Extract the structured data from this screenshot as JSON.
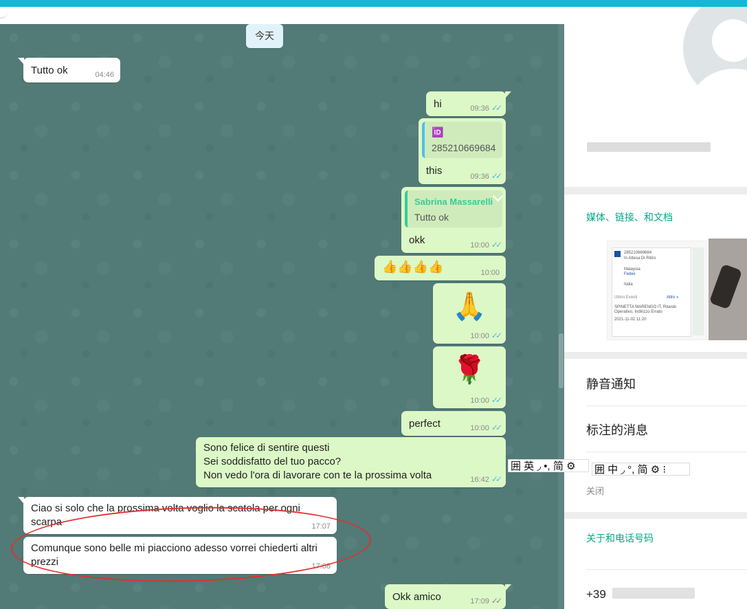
{
  "date_chip": "今天",
  "messages": [
    {
      "text": "Tutto ok",
      "time": "04:46"
    },
    {
      "text": "hi",
      "time": "09:36",
      "ticks": "✓✓"
    },
    {
      "quote_icon": "🆔",
      "quote_text": "285210669684",
      "text": "this",
      "time": "09:36",
      "ticks": "✓✓"
    },
    {
      "quote_name": "Sabrina Massarelli",
      "quote_text": "Tutto ok",
      "text": "okk",
      "time": "10:00",
      "ticks": "✓✓"
    },
    {
      "text": "👍👍👍👍",
      "time": "10:00"
    },
    {
      "text": "🙏",
      "time": "10:00",
      "ticks": "✓✓"
    },
    {
      "text": "🌹",
      "time": "10:00",
      "ticks": "✓✓"
    },
    {
      "text": "perfect",
      "time": "10:00",
      "ticks": "✓✓"
    },
    {
      "text": "Sono felice di sentire questi\nSei soddisfatto del tuo pacco?\nNon vedo l'ora di lavorare con te la prossima volta",
      "time": "16:42",
      "ticks": "✓✓"
    },
    {
      "text": "Ciao si solo che la prossima volta voglio la scatola per ogni\nscarpa",
      "time": "17:07"
    },
    {
      "text": "Comunque sono belle mi piacciono adesso vorrei chiederti altri\nprezzi",
      "time": "17:08"
    },
    {
      "text": "Okk amico",
      "time": "17:09",
      "ticks": "✓✓"
    }
  ],
  "panel": {
    "media_title": "媒体、链接、和文档",
    "thumb_lines": [
      "285210669684",
      "In Attesa Di Ritiro",
      "Malaysia",
      "Fedex",
      "Italia",
      "Ultimi Eventi",
      "Altro »",
      "SPINETTA MARENGO IT, Ritardo",
      "Operativo, Indirizzo Errato",
      "2021-11-02 11:20"
    ],
    "mute_label": "静音通知",
    "starred_label": "标注的消息",
    "disappearing_sub": "关闭",
    "about_title": "关于和电话号码",
    "phone_prefix": "+39"
  },
  "ime_bars": [
    {
      "text": "囲 英 ◞ •, 简 ⚙"
    },
    {
      "text": "囲 中 ◞ °, 简 ⚙ ⁝"
    }
  ],
  "colors": {
    "chat_bg": "#527a77",
    "bubble_in": "#ffffff",
    "bubble_out": "#dcf8c6",
    "accent": "#00a884",
    "read_ticks": "#4fb6ec",
    "highlight_ellipse": "#e0302f",
    "topbar": "#12b8d4"
  }
}
